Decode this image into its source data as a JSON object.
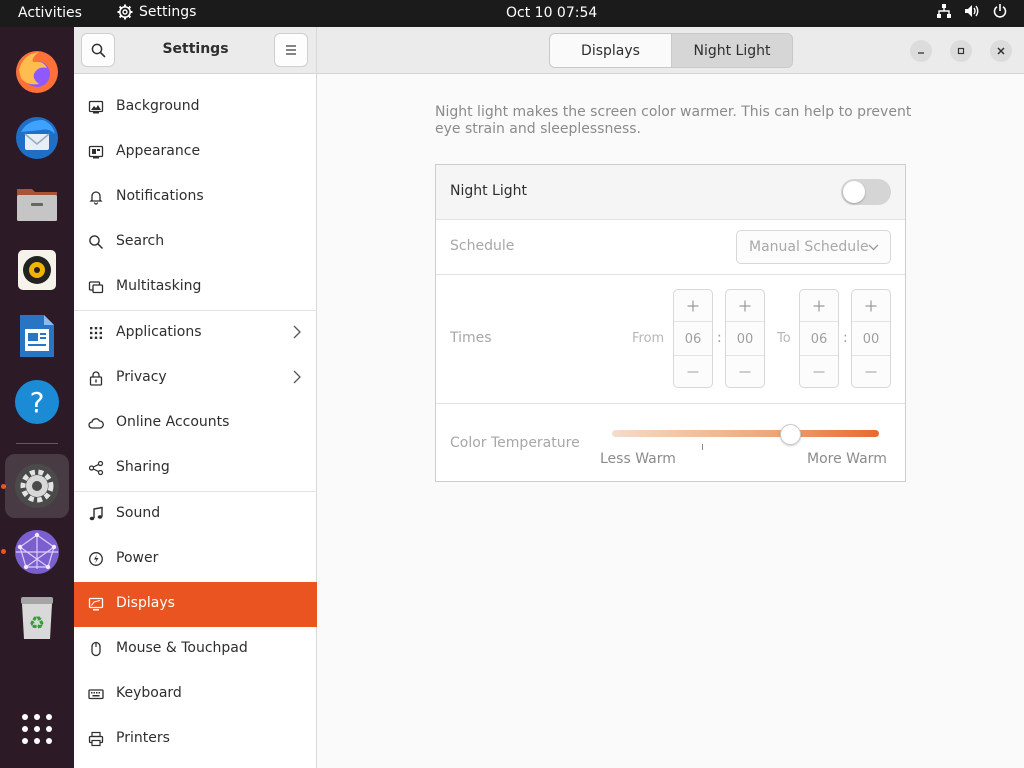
{
  "topbar": {
    "activities": "Activities",
    "app_name": "Settings",
    "clock": "Oct 10  07:54"
  },
  "dock": {
    "apps": [
      {
        "name": "Firefox",
        "icon": "firefox-icon"
      },
      {
        "name": "Thunderbird",
        "icon": "thunderbird-icon"
      },
      {
        "name": "Files",
        "icon": "files-icon"
      },
      {
        "name": "Rhythmbox",
        "icon": "rhythmbox-icon"
      },
      {
        "name": "LibreOffice Writer",
        "icon": "writer-icon"
      },
      {
        "name": "Help",
        "icon": "help-icon"
      },
      {
        "name": "Settings",
        "icon": "settings-icon"
      },
      {
        "name": "Network app",
        "icon": "network-app-icon"
      },
      {
        "name": "Trash",
        "icon": "trash-icon"
      },
      {
        "name": "Show Applications",
        "icon": "app-grid-icon"
      }
    ]
  },
  "sidebar": {
    "title": "Settings",
    "items": [
      {
        "label": "Background",
        "icon": "background-icon"
      },
      {
        "label": "Appearance",
        "icon": "appearance-icon"
      },
      {
        "label": "Notifications",
        "icon": "bell-icon"
      },
      {
        "label": "Search",
        "icon": "search-icon"
      },
      {
        "label": "Multitasking",
        "icon": "multitasking-icon"
      },
      {
        "label": "Applications",
        "icon": "apps-grid-icon"
      },
      {
        "label": "Privacy",
        "icon": "lock-icon"
      },
      {
        "label": "Online Accounts",
        "icon": "cloud-icon"
      },
      {
        "label": "Sharing",
        "icon": "share-icon"
      },
      {
        "label": "Sound",
        "icon": "music-note-icon"
      },
      {
        "label": "Power",
        "icon": "power-icon"
      },
      {
        "label": "Displays",
        "icon": "display-icon"
      },
      {
        "label": "Mouse & Touchpad",
        "icon": "mouse-icon"
      },
      {
        "label": "Keyboard",
        "icon": "keyboard-icon"
      },
      {
        "label": "Printers",
        "icon": "printer-icon"
      }
    ],
    "selected": "Displays"
  },
  "header": {
    "tabs": [
      {
        "label": "Displays",
        "active": false
      },
      {
        "label": "Night Light",
        "active": true
      }
    ]
  },
  "night_light": {
    "description": "Night light makes the screen color warmer. This can help to prevent eye strain and sleeplessness.",
    "toggle_label": "Night Light",
    "enabled": false,
    "schedule_label": "Schedule",
    "schedule_value": "Manual Schedule",
    "times_label": "Times",
    "from_label": "From",
    "to_label": "To",
    "from_hour": "06",
    "from_minute": "00",
    "to_hour": "06",
    "to_minute": "00",
    "temperature_label": "Color Temperature",
    "less_warm": "Less Warm",
    "more_warm": "More Warm",
    "temperature_level": 0.67
  },
  "colors": {
    "accent": "#e95420",
    "dock_bg": "#2c1b26",
    "topbar_bg": "#1b1b1b"
  }
}
